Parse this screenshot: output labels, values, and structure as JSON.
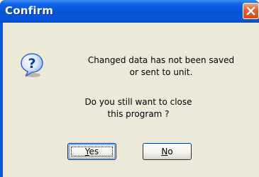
{
  "window": {
    "title": "Confirm",
    "close_icon": "close-icon",
    "colors": {
      "titlebar": "#0653d8",
      "close_button": "#d24a1f",
      "dialog_background": "#ece9d8"
    }
  },
  "dialog": {
    "icon": "question-icon",
    "message_line1": "Changed data has not been saved",
    "message_line2": "or sent to unit.",
    "question_line1": "Do you still want to close",
    "question_line2": "this program ?"
  },
  "buttons": {
    "yes_mnemonic": "Y",
    "yes_rest": "es",
    "no_mnemonic": "N",
    "no_rest": "o"
  }
}
